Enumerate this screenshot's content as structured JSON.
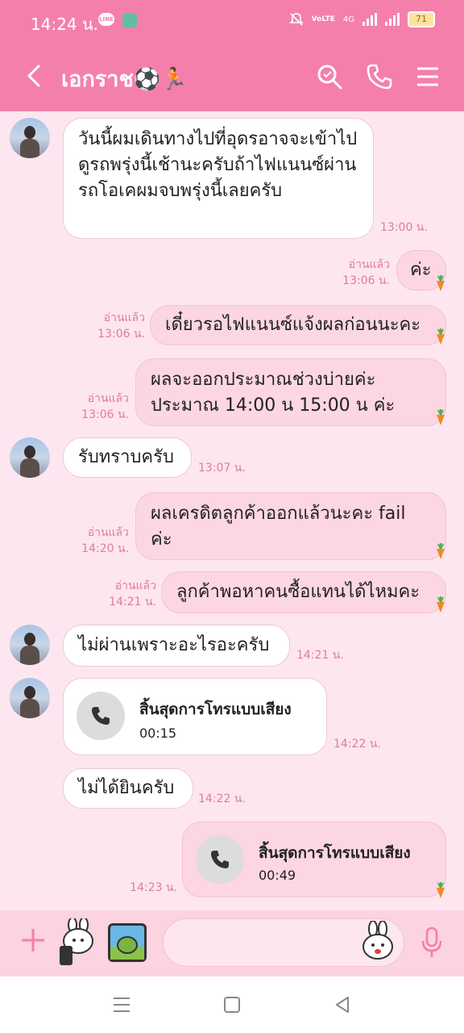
{
  "status": {
    "time": "14:24 น.",
    "battery": "71",
    "net": "4G",
    "volte": "VoLTE"
  },
  "header": {
    "title": "เอกราช⚽🏃"
  },
  "messages": {
    "m1": {
      "text": "วันนี้ผมเดินทางไปที่อุดรอาจจะเข้าไปดูรถพรุ่งนี้เช้านะครับถ้าไฟแนนซ์ผ่านรถโอเคผมจบพรุ่งนี้เลยครับ",
      "time": "13:00 น."
    },
    "m2": {
      "text": "ค่ะ",
      "read": "อ่านแล้ว",
      "time": "13:06 น."
    },
    "m3": {
      "text": "เดี๋ยวรอไฟแนนซ์แจ้งผลก่อนนะคะ",
      "read": "อ่านแล้ว",
      "time": "13:06 น."
    },
    "m4": {
      "text": "ผลจะออกประมาณช่วงบ่ายค่ะ ประมาณ 14:00 น 15:00 น ค่ะ",
      "read": "อ่านแล้ว",
      "time": "13:06 น."
    },
    "m5": {
      "text": "รับทราบครับ",
      "time": "13:07 น."
    },
    "m6": {
      "text": "ผลเครดิตลูกค้าออกแล้วนะคะ fail ค่ะ",
      "read": "อ่านแล้ว",
      "time": "14:20 น."
    },
    "m7": {
      "text": "ลูกค้าพอหาคนซื้อแทนได้ไหมคะ",
      "read": "อ่านแล้ว",
      "time": "14:21 น."
    },
    "m8": {
      "text": "ไม่ผ่านเพราะอะไรอะครับ",
      "time": "14:21 น."
    },
    "m9": {
      "title": "สิ้นสุดการโทรแบบเสียง",
      "duration": "00:15",
      "time": "14:22 น."
    },
    "m10": {
      "text": "ไม่ได้ยินครับ",
      "time": "14:22 น."
    },
    "m11": {
      "title": "สิ้นสุดการโทรแบบเสียง",
      "duration": "00:49",
      "time": "14:23 น."
    }
  },
  "colors": {
    "header": "#f57fab",
    "background": "#fde6ef",
    "outgoing": "#fcd6e3",
    "time": "#e07aa0"
  }
}
